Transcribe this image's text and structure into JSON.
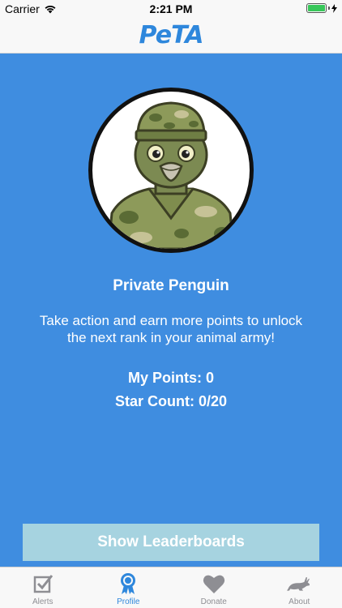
{
  "status_bar": {
    "carrier": "Carrier",
    "time": "2:21 PM",
    "battery_level": 1.0
  },
  "nav": {
    "logo_text": "PeTA"
  },
  "profile": {
    "avatar_icon": "soldier-penguin-avatar",
    "rank_title": "Private Penguin",
    "description": "Take action and earn more points to unlock the next rank in your animal army!",
    "points_text": "My Points: 0",
    "stars_text": "Star Count: 0/20"
  },
  "leaderboard_button": "Show Leaderboards",
  "tabs": [
    {
      "label": "Alerts",
      "icon": "checkbox-icon",
      "active": false
    },
    {
      "label": "Profile",
      "icon": "ribbon-badge-icon",
      "active": true
    },
    {
      "label": "Donate",
      "icon": "heart-icon",
      "active": false
    },
    {
      "label": "About",
      "icon": "rabbit-icon",
      "active": false
    }
  ],
  "colors": {
    "background": "#3f8de0",
    "accent": "#2e87dc",
    "button": "#a6d3e0",
    "tab_inactive": "#8e8e93"
  }
}
